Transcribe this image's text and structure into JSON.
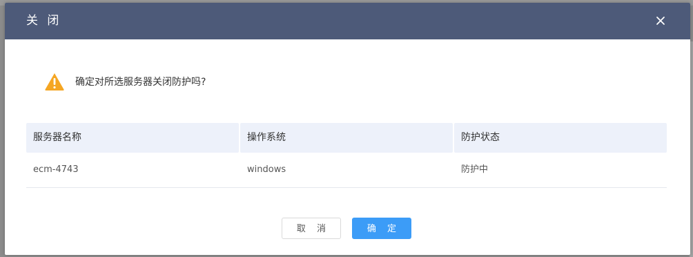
{
  "dialog": {
    "title": "关 闭",
    "close_icon": "close-icon",
    "warning_icon": "warning-triangle-icon",
    "message": "确定对所选服务器关闭防护吗?",
    "cancel_label": "取 消",
    "confirm_label": "确 定"
  },
  "table": {
    "columns": [
      "服务器名称",
      "操作系统",
      "防护状态"
    ],
    "rows": [
      [
        "ecm-4743",
        "windows",
        "防护中"
      ]
    ]
  },
  "colors": {
    "header_bg": "#4d5a79",
    "primary": "#3c9cf7",
    "warning": "#f5a623",
    "table_header_bg": "#edf1fa"
  }
}
